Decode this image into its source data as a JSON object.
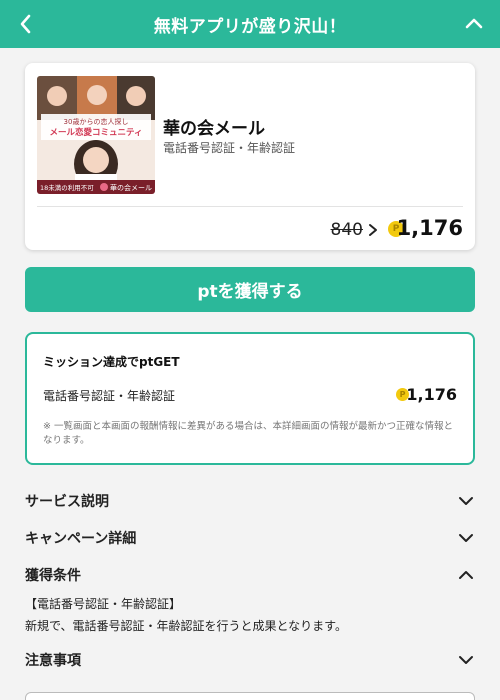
{
  "header": {
    "title": "無料アプリが盛り沢山！",
    "back_icon": "chevron-left-icon",
    "collapse_icon": "chevron-up-icon",
    "color": "#2bb89a"
  },
  "offer": {
    "thumb_texts": [
      "30歳からの恋人探し",
      "メール恋愛コミュニティ",
      "18未満の利用不可",
      "華の会メール"
    ],
    "name": "華の会メール",
    "subtitle": "電話番号認証・年齢認証",
    "old_points": "840",
    "new_points": "1,176",
    "coin_letter": "P"
  },
  "get_button": {
    "label": "ptを獲得する"
  },
  "mission": {
    "title": "ミッション達成でptGET",
    "task": "電話番号認証・年齢認証",
    "points": "1,176",
    "note": "※ 一覧画面と本画面の報酬情報に差異がある場合は、本詳細画面の情報が最新かつ正確な情報となります。"
  },
  "sections": {
    "service": {
      "label": "サービス説明",
      "state": "collapsed"
    },
    "campaign": {
      "label": "キャンペーン詳細",
      "state": "collapsed"
    },
    "conditions": {
      "label": "獲得条件",
      "state": "expanded",
      "line1": "【電話番号認証・年齢認証】",
      "line2": "新規で、電話番号認証・年齢認証を行うと成果となります。"
    },
    "notes": {
      "label": "注意事項",
      "state": "collapsed"
    }
  }
}
